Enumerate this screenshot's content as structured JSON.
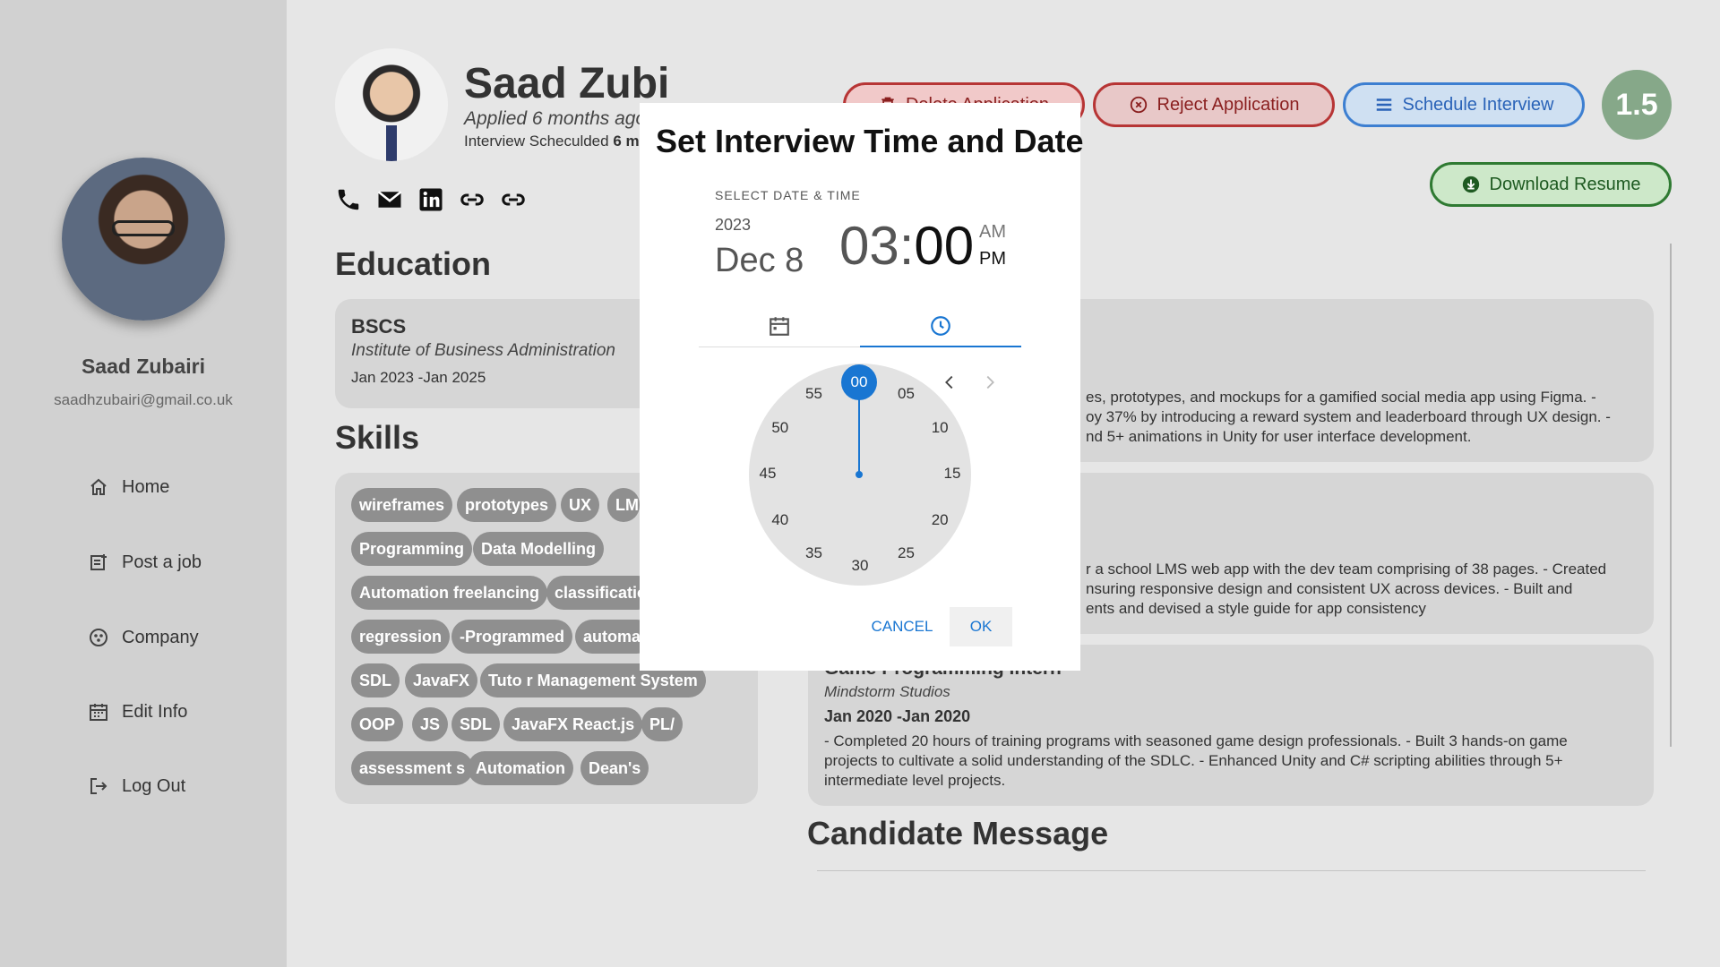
{
  "sidebar": {
    "name": "Saad Zubairi",
    "email": "saadhzubairi@gmail.co.uk",
    "nav": [
      {
        "label": "Home",
        "icon": "home-icon"
      },
      {
        "label": "Post a job",
        "icon": "post-job-icon"
      },
      {
        "label": "Company",
        "icon": "company-icon"
      },
      {
        "label": "Edit Info",
        "icon": "calendar-icon"
      },
      {
        "label": "Log Out",
        "icon": "logout-icon"
      }
    ]
  },
  "profile": {
    "name": "Saad Zubi",
    "applied": "Applied 6 months ago",
    "scheduled_prefix": "Interview Scheculded",
    "scheduled_value": "6 m"
  },
  "actions": {
    "delete": "Delete Application",
    "reject": "Reject Application",
    "schedule": "Schedule Interview",
    "download": "Download Resume",
    "score": "1.5"
  },
  "education": {
    "title": "Education",
    "degree": "BSCS",
    "institute": "Institute of Business Administration",
    "dates": "Jan 2023 -Jan 2025"
  },
  "skills": {
    "title": "Skills",
    "chips": [
      "wireframes",
      "prototypes",
      "UX",
      "LM",
      "Programming",
      "Data Modelling",
      "Automation freelancing",
      "classificatio",
      "regression",
      "-Programmed",
      "automat",
      "SDL",
      "JavaFX",
      "Tuto r Management System",
      "OOP",
      "JS",
      "SDL",
      "JavaFX React.js",
      "PL/",
      "assessment s",
      "Automation",
      "Dean's"
    ]
  },
  "experience": [
    {
      "lines": [
        "es, prototypes, and mockups for a gamified social media app using Figma. -",
        "oy 37% by introducing a reward system and leaderboard through UX design. -",
        "nd 5+ animations in Unity for user interface development."
      ]
    },
    {
      "lines": [
        "r a school LMS web app with the dev team comprising of 38 pages. - Created",
        "nsuring responsive design and consistent UX across devices. - Built and",
        "ents and devised a style guide for app consistency"
      ]
    },
    {
      "title": "Game Programming Intern",
      "company": "Mindstorm Studios",
      "dates": "Jan 2020 -Jan 2020",
      "lines": [
        "- Completed 20 hours of training programs with seasoned game design professionals. - Built 3 hands-on game",
        "projects to cultivate a solid understanding of the SDLC. - Enhanced Unity and C# scripting abilities through 5+",
        "intermediate level projects."
      ]
    }
  ],
  "candidate_message": {
    "title": "Candidate Message"
  },
  "modal": {
    "title": "Set Interview Time and Date",
    "label": "SELECT DATE & TIME",
    "year": "2023",
    "date": "Dec 8",
    "hour": "03",
    "colon": ":",
    "minute": "00",
    "am": "AM",
    "pm": "PM",
    "selected_minute": "00",
    "clock_numbers": [
      "05",
      "10",
      "15",
      "20",
      "25",
      "30",
      "35",
      "40",
      "45",
      "50",
      "55"
    ],
    "cancel": "CANCEL",
    "ok": "OK",
    "accent": "#1976d2"
  }
}
